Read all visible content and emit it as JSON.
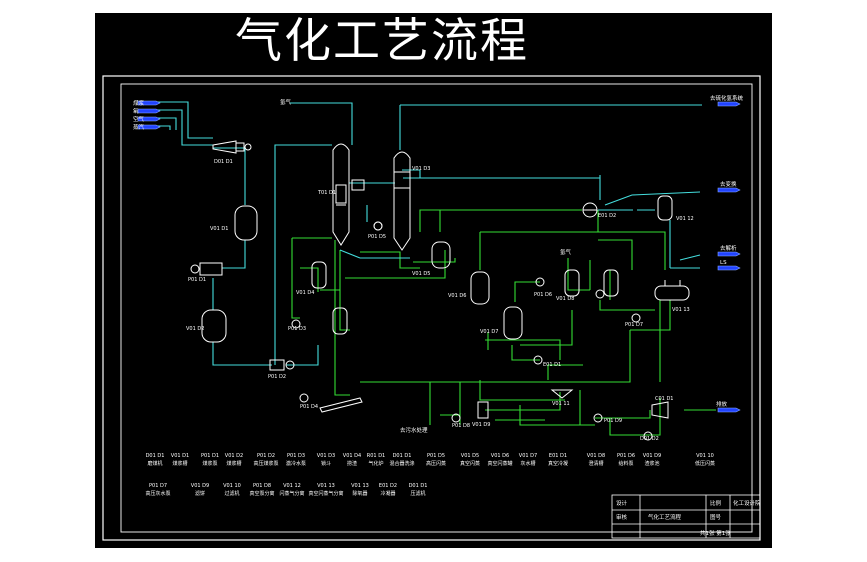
{
  "title": "气化工艺流程",
  "colors": {
    "background": "#000000",
    "frame": "#ffffff",
    "pipe_green": "#33dd33",
    "pipe_cyan": "#44dddd",
    "arrow_blue": "#2244ff",
    "vessel": "#ffffff"
  },
  "streams": {
    "top_in": "氢气",
    "top_right": "去硫化氢系统",
    "right_1": "去变换",
    "right_2": "去解析",
    "right_3": "LS",
    "bottom_right": "排放",
    "bottom_mid": "去污水处理",
    "mid": "氢气"
  },
  "feed_inputs": [
    "煤浆",
    "氧",
    "空气",
    "蒸汽"
  ],
  "equipment": {
    "d01": "D01 D1",
    "v01": "V01 D1",
    "p01": "P01 D1",
    "v02": "V01 D2",
    "p02": "P01 D2",
    "p03": "P01 D3",
    "p04": "P01 D4",
    "p05": "P01 D5",
    "p06": "P01 D6",
    "p07": "P01 D7",
    "p08": "P01 D8",
    "p09": "P01 D9",
    "t01": "T01 D1",
    "v03": "V01 D3",
    "v04": "V01 D4",
    "v05": "V01 D5",
    "v06": "V01 D6",
    "v07": "V01 D7",
    "v08": "V01 D8",
    "v09": "V01 D9",
    "v10": "V01 10",
    "e01": "E01 D1",
    "e02": "E01 D2",
    "d02": "D01 D2",
    "x11": "V01 11",
    "x12": "V01 12",
    "x13": "V01 13",
    "c01": "C01 D1"
  },
  "legend_row1": [
    {
      "tag": "D01 D1",
      "name": "磨煤机"
    },
    {
      "tag": "V01 D1",
      "name": "煤浆槽"
    },
    {
      "tag": "P01 D1",
      "name": "煤浆泵"
    },
    {
      "tag": "V01 D2",
      "name": "煤浆槽"
    },
    {
      "tag": "P01 D2",
      "name": "高压煤浆泵"
    },
    {
      "tag": "P01 D3",
      "name": "激冷水泵"
    },
    {
      "tag": "V01 D3",
      "name": "锁斗"
    },
    {
      "tag": "V01 D4",
      "name": "捞渣"
    },
    {
      "tag": "R01 D1",
      "name": "气化炉"
    },
    {
      "tag": "D01 D1",
      "name": "混合器洗涤"
    },
    {
      "tag": "P01 D5",
      "name": "高压闪蒸"
    },
    {
      "tag": "V01 D5",
      "name": "真空闪蒸"
    },
    {
      "tag": "V01 D6",
      "name": "真空闪蒸罐"
    },
    {
      "tag": "V01 D7",
      "name": "灰水槽"
    },
    {
      "tag": "E01 D1",
      "name": "真空冷凝"
    },
    {
      "tag": "V01 D8",
      "name": "澄清槽"
    },
    {
      "tag": "P01 D6",
      "name": "给料泵"
    },
    {
      "tag": "V01 D9",
      "name": "渣浆池"
    },
    {
      "tag": "V01 10",
      "name": "低压闪蒸"
    }
  ],
  "legend_row2": [
    {
      "tag": "P01 D7",
      "name": "高压灰水泵"
    },
    {
      "tag": "V01 D9",
      "name": "滤饼"
    },
    {
      "tag": "V01 10",
      "name": "过滤机"
    },
    {
      "tag": "P01 D8",
      "name": "真空泵分离"
    },
    {
      "tag": "V01 12",
      "name": "闪蒸气分离"
    },
    {
      "tag": "V01 13",
      "name": "真空闪蒸气分离"
    },
    {
      "tag": "V01 13",
      "name": "除氧器"
    },
    {
      "tag": "E01 D2",
      "name": "冷凝器"
    },
    {
      "tag": "D01 D1",
      "name": "压滤机"
    }
  ],
  "title_block": {
    "name": "气化工艺流程",
    "label1": "设计",
    "label2": "审核",
    "label3": "比例",
    "label4": "图号",
    "company": "化工设计院",
    "sheet": "共1张 第1张"
  }
}
